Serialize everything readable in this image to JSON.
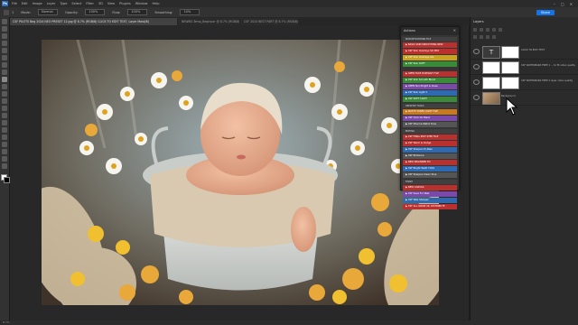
{
  "menubar": {
    "app_logo": "Ps",
    "items": [
      "File",
      "Edit",
      "Image",
      "Layer",
      "Type",
      "Select",
      "Filter",
      "3D",
      "View",
      "Plugins",
      "Window",
      "Help"
    ],
    "window_controls": [
      "–",
      "□",
      "✕"
    ]
  },
  "options_bar": {
    "brush_size": "1",
    "mode_label": "Mode:",
    "mode_value": "Normal",
    "opacity_label": "Opacity:",
    "opacity_value": "100%",
    "flow_label": "Flow:",
    "flow_value": "100%",
    "smoothing_label": "Smoothing:",
    "smoothing_value": "10%",
    "share_label": "Share"
  },
  "tabs": [
    {
      "label": "CSF PILOTS Beg 2024 NEO PRESET 12.jpg @ 8.7% (RGB/8) CLICK TO EDIT TEXT, Layer Mask/8)",
      "active": true
    },
    {
      "label": "NEWBO-Temp_Beginpar @ 8.7% (RGB/8)",
      "active": false
    },
    {
      "label": "CSF 2024 BEST PART @ 8.7% (RGB/8)",
      "active": false
    }
  ],
  "actions_panel": {
    "title": "Actions",
    "close": "✕",
    "rows": [
      {
        "label": "SKIN RETOUCHING FILE",
        "kind": "set",
        "color": "#404040"
      },
      {
        "label": "▶ BASIC SKIN SMOOTHING NEW",
        "kind": "action",
        "color": "#b8312f"
      },
      {
        "label": "▶ CSF Skin Overlays SQ PRO",
        "kind": "action",
        "color": "#b8312f"
      },
      {
        "label": "▶ CSF Skin Overlays ALL",
        "kind": "action",
        "color": "#c9a21e"
      },
      {
        "label": "▶ CSF Skin SOFT",
        "kind": "action",
        "color": "#3a8a3a"
      },
      {
        "label": "",
        "kind": "spacer",
        "color": "#353535"
      },
      {
        "label": "▶ OPEN FACE PORTRAIT FILE",
        "kind": "action",
        "color": "#b8312f"
      },
      {
        "label": "▶ CSF Skin Smooth Blend",
        "kind": "action",
        "color": "#3a8a3a"
      },
      {
        "label": "▶ OPEN Skin Bright & Clean",
        "kind": "action",
        "color": "#7a4aa8"
      },
      {
        "label": "▶ CSF Skin Light 3",
        "kind": "action",
        "color": "#2f6ab0"
      },
      {
        "label": "▶ CSF SOFT LIGHT",
        "kind": "action",
        "color": "#3a8a3a"
      },
      {
        "label": "CREATIVE TOOLS",
        "kind": "set",
        "color": "#404040"
      },
      {
        "label": "▶ MATTE TONES LIGHT FILE",
        "kind": "action",
        "color": "#c97a1e"
      },
      {
        "label": "▶ CSF Click On Black",
        "kind": "action",
        "color": "#7a4aa8"
      },
      {
        "label": "▶ CSF Mood & Match Tone",
        "kind": "action",
        "color": "#555555"
      },
      {
        "label": "EDITING",
        "kind": "set",
        "color": "#404040"
      },
      {
        "label": "▶ CSF FINAL EDIT STEP FILE",
        "kind": "action",
        "color": "#b8312f"
      },
      {
        "label": "▶ CSF Warm & Dodge",
        "kind": "action",
        "color": "#b8312f"
      },
      {
        "label": "▶ CSF Sharpen Hi-Pass",
        "kind": "action",
        "color": "#2f6ab0"
      },
      {
        "label": "▶ CSF Brilliance",
        "kind": "action",
        "color": "#555555"
      },
      {
        "label": "▶ NEW BEGINNER Fill",
        "kind": "action",
        "color": "#b8312f"
      },
      {
        "label": "▶ CSF Bright Teeth TOOL",
        "kind": "action",
        "color": "#2f6ab0"
      },
      {
        "label": "▶ CSF Sharpen Clean Tone",
        "kind": "action",
        "color": "#555555"
      },
      {
        "label": "FINISH",
        "kind": "set",
        "color": "#404040"
      },
      {
        "label": "▶ NEW CANVAS",
        "kind": "action",
        "color": "#b8312f"
      },
      {
        "label": "▶ CSF Save For Web",
        "kind": "action",
        "color": "#7a4aa8"
      },
      {
        "label": "▶ CSF Web Sharpen",
        "kind": "action",
        "color": "#2f6ab0"
      },
      {
        "label": "▶ CSF ALL GRAIN 4K, DISTRIBUTE",
        "kind": "action",
        "color": "#b8312f"
      }
    ]
  },
  "layers_panel": {
    "tab_label": "Layers",
    "layers": [
      {
        "name": "CLICK TO EDIT TEXT",
        "type": "text"
      },
      {
        "name": "CSF WATERMARK FREE 1 ... to fit video quality",
        "type": "mask"
      },
      {
        "name": "CSF WATERMARK FREE 2 layer video quality",
        "type": "mask"
      },
      {
        "name": "Background",
        "type": "photo"
      }
    ]
  },
  "status": {
    "zoom": "8.7%"
  },
  "colors": {
    "accent": "#1473e6",
    "panel": "#2b2b2b"
  }
}
